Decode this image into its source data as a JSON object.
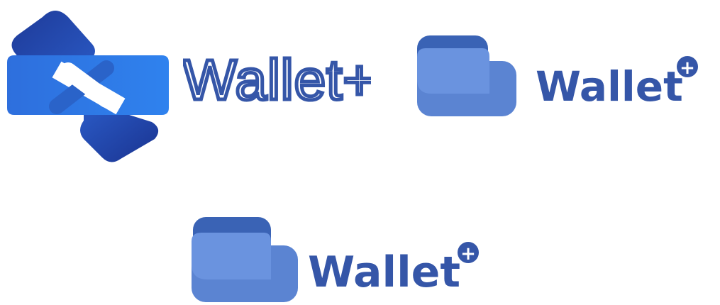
{
  "logos": [
    {
      "wordmark": "Wallet+",
      "style": "thin-outline",
      "color": "#3556A8"
    },
    {
      "wordmark": "Wallet",
      "badge": "+",
      "style": "bold",
      "color": "#3556A8"
    },
    {
      "wordmark": "Wallet",
      "badge": "+",
      "style": "bold",
      "color": "#3556A8"
    }
  ],
  "colors": {
    "dark_blue": "#1F3D9C",
    "mid_blue": "#2A63C9",
    "bright_blue": "#2E7EEB",
    "wallet_top": "#3A63B5",
    "wallet_body": "#6890DE",
    "wallet_front": "#5B84D2",
    "text_blue": "#3556A8"
  }
}
